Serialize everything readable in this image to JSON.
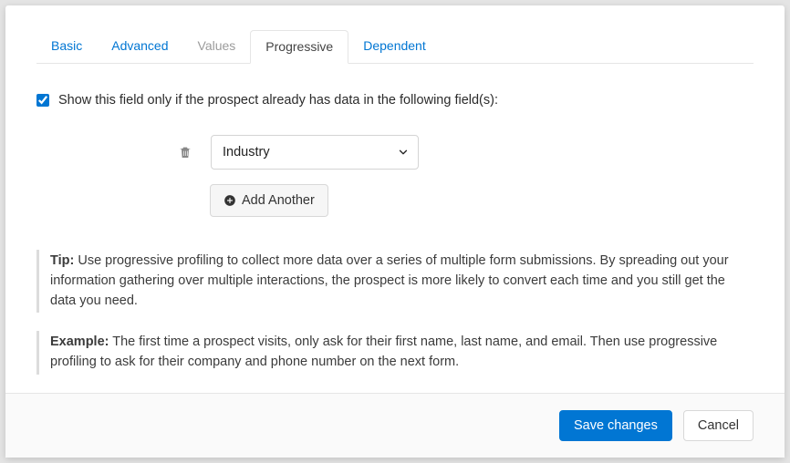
{
  "tabs": {
    "items": [
      {
        "label": "Basic",
        "active": false,
        "muted": false
      },
      {
        "label": "Advanced",
        "active": false,
        "muted": false
      },
      {
        "label": "Values",
        "active": false,
        "muted": true
      },
      {
        "label": "Progressive",
        "active": true,
        "muted": false
      },
      {
        "label": "Dependent",
        "active": false,
        "muted": false
      }
    ]
  },
  "checkbox": {
    "checked": true,
    "label": "Show this field only if the prospect already has data in the following field(s):"
  },
  "field_select": {
    "selected": "Industry"
  },
  "add_another_label": "Add Another",
  "notes": {
    "tip_label": "Tip:",
    "tip_text": " Use progressive profiling to collect more data over a series of multiple form submissions. By spreading out your information gathering over multiple interactions, the prospect is more likely to convert each time and you still get the data you need.",
    "example_label": "Example:",
    "example_text": " The first time a prospect visits, only ask for their first name, last name, and email. Then use progressive profiling to ask for their company and phone number on the next form."
  },
  "footer": {
    "save_label": "Save changes",
    "cancel_label": "Cancel"
  }
}
